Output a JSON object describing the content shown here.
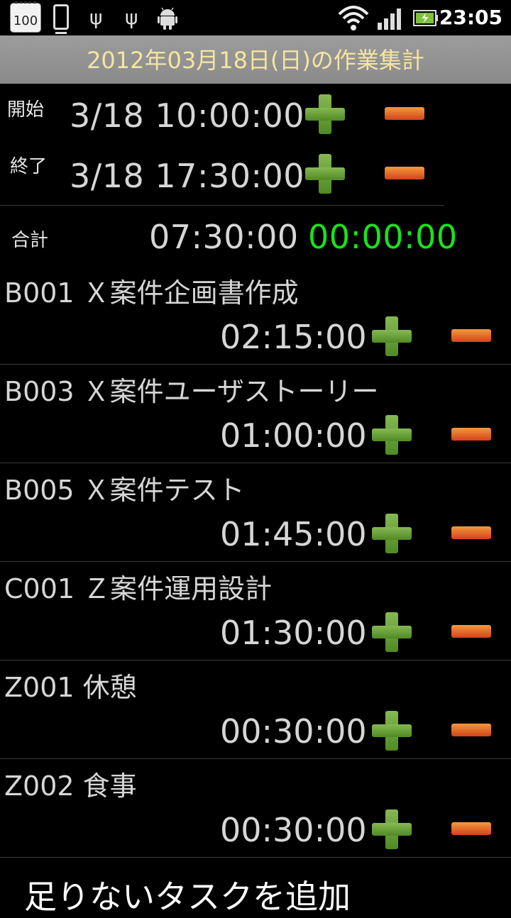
{
  "status_bar": {
    "calendar_badge": "100",
    "time": "23:05",
    "icons": [
      "calendar-icon",
      "phone-icon",
      "usb-icon",
      "usb-icon",
      "android-icon",
      "wifi-icon",
      "signal-icon",
      "battery-icon"
    ]
  },
  "header": {
    "title": "2012年03月18日(日)の作業集計"
  },
  "period": {
    "start_label": "開始",
    "start_value": "3/18 10:00:00",
    "end_label": "終了",
    "end_value": "3/18 17:30:00",
    "total_label": "合計",
    "total_value": "07:30:00",
    "diff_value": "00:00:00"
  },
  "tasks": [
    {
      "name": "B001 Ｘ案件企画書作成",
      "time": "02:15:00"
    },
    {
      "name": "B003 Ｘ案件ユーザストーリー",
      "time": "01:00:00"
    },
    {
      "name": "B005 Ｘ案件テスト",
      "time": "01:45:00"
    },
    {
      "name": "C001 Ｚ案件運用設計",
      "time": "01:30:00"
    },
    {
      "name": "Z001 休憩",
      "time": "00:30:00"
    },
    {
      "name": "Z002 食事",
      "time": "00:30:00"
    }
  ],
  "add_task_label": "足りないタスクを追加",
  "colors": {
    "accent_green": "#19e319",
    "plus": "#6aa23a",
    "minus": "#e2642a",
    "title_text": "#f5e5a0"
  }
}
